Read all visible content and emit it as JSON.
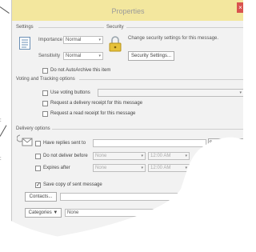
{
  "window": {
    "title": "Properties",
    "close_glyph": "×"
  },
  "settings": {
    "label": "Settings",
    "importance_label": "Importance",
    "importance_value": "Normal",
    "sensitivity_label": "Sensitivity",
    "sensitivity_value": "Normal",
    "autoarchive_label": "Do not AutoArchive this item",
    "autoarchive_checked": false
  },
  "security": {
    "label": "Security",
    "description": "Change security settings for this message.",
    "button_label": "Security Settings..."
  },
  "voting": {
    "label": "Voting and Tracking options",
    "use_voting_label": "Use voting buttons",
    "delivery_receipt_label": "Request a delivery receipt for this message",
    "read_receipt_label": "Request a read receipt for this message"
  },
  "delivery": {
    "label": "Delivery options",
    "have_replies_label": "Have replies sent to",
    "select_names_label": "Select Names...",
    "do_not_deliver_label": "Do not deliver before",
    "do_not_deliver_date": "None",
    "do_not_deliver_time": "12:00 AM",
    "expires_label": "Expires after",
    "expires_date": "None",
    "expires_time": "12:00 AM",
    "save_copy_label": "Save copy of sent message",
    "save_copy_checked": true
  },
  "contacts": {
    "button_label": "Contacts..."
  },
  "categories": {
    "button_label": "Categories",
    "value": "None"
  },
  "icons": {
    "settings": "document-lines-icon",
    "security": "lock-icon",
    "delivery": "envelope-arrow-icon"
  },
  "colors": {
    "titlebar": "#f3e79e",
    "close": "#d9534f",
    "dialog_bg": "#f2f2f2"
  }
}
